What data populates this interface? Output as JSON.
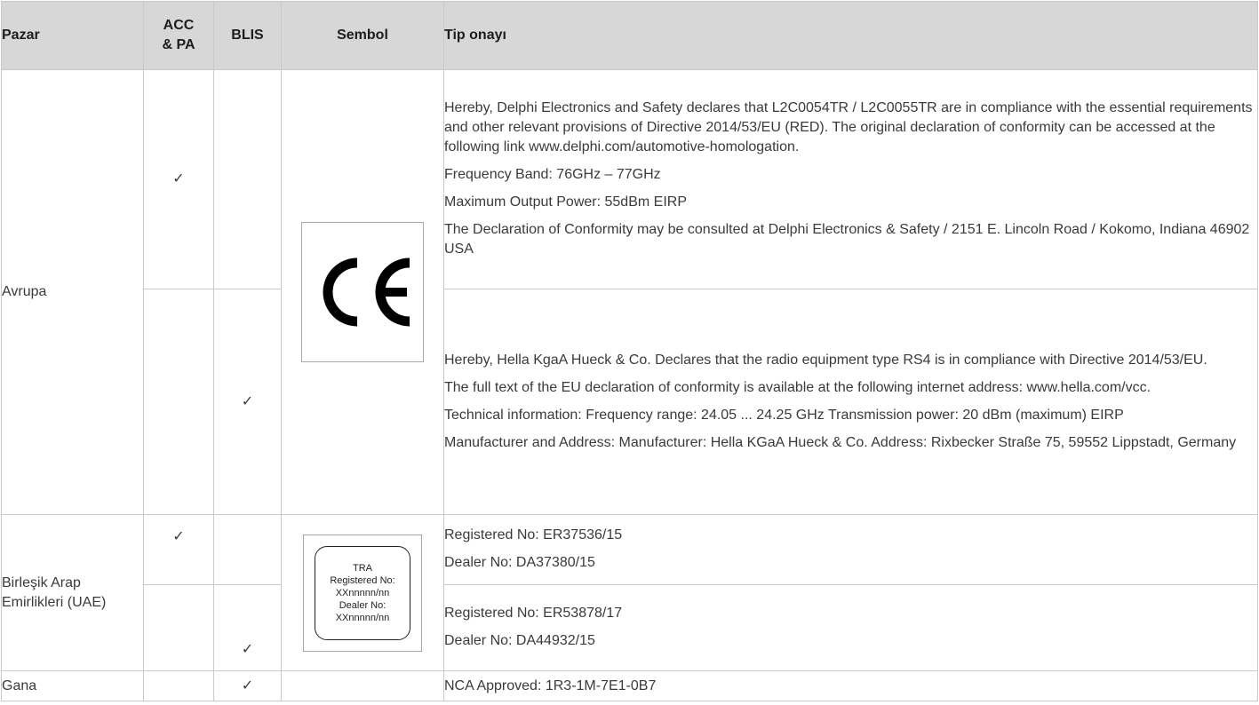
{
  "header": {
    "market": "Pazar",
    "acc_pa": "ACC\n& PA",
    "acc_line1": "ACC",
    "acc_line2": "& PA",
    "blis": "BLIS",
    "symbol": "Sembol",
    "approval": "Tip onayı"
  },
  "check": "✓",
  "rows": {
    "europe": {
      "market": "Avrupa",
      "symbol": "CE",
      "acc": {
        "paragraphs": [
          "Hereby, Delphi Electronics and Safety declares that L2C0054TR / L2C0055TR are in compliance with the essential requirements and other relevant provisions of Directive 2014/53/EU (RED). The original declaration of conformity can be accessed at the following link www.delphi.com/automotive-homologation.",
          "Frequency Band: 76GHz – 77GHz",
          "Maximum Output Power: 55dBm EIRP",
          "The Declaration of Conformity may be consulted at Delphi Electronics & Safety / 2151 E. Lincoln Road / Kokomo, Indiana 46902 USA"
        ]
      },
      "blis": {
        "paragraphs": [
          "Hereby, Hella KgaA Hueck & Co. Declares that the radio equipment type RS4 is in compliance with Directive 2014/53/EU.",
          "The full text of the EU declaration of conformity is available at the following internet address: www.hella.com/vcc.",
          "Technical information: Frequency range: 24.05 ... 24.25 GHz Transmission power: 20 dBm (maximum) EIRP",
          "Manufacturer and Address: Manufacturer: Hella KGaA Hueck & Co. Address: Rixbecker Straße 75, 59552 Lippstadt, Germany"
        ]
      }
    },
    "uae": {
      "market": "Birleşik Arap Emirlikleri (UAE)",
      "symbol_lines": [
        "TRA",
        "Registered No:",
        "XXnnnnn/nn",
        "Dealer No:",
        "XXnnnnn/nn"
      ],
      "acc": {
        "paragraphs": [
          "Registered No: ER37536/15",
          "Dealer No: DA37380/15"
        ]
      },
      "blis": {
        "paragraphs": [
          "Registered No: ER53878/17",
          "Dealer No: DA44932/15"
        ]
      }
    },
    "ghana": {
      "market": "Gana",
      "approval": "NCA Approved: 1R3-1M-7E1-0B7"
    }
  }
}
